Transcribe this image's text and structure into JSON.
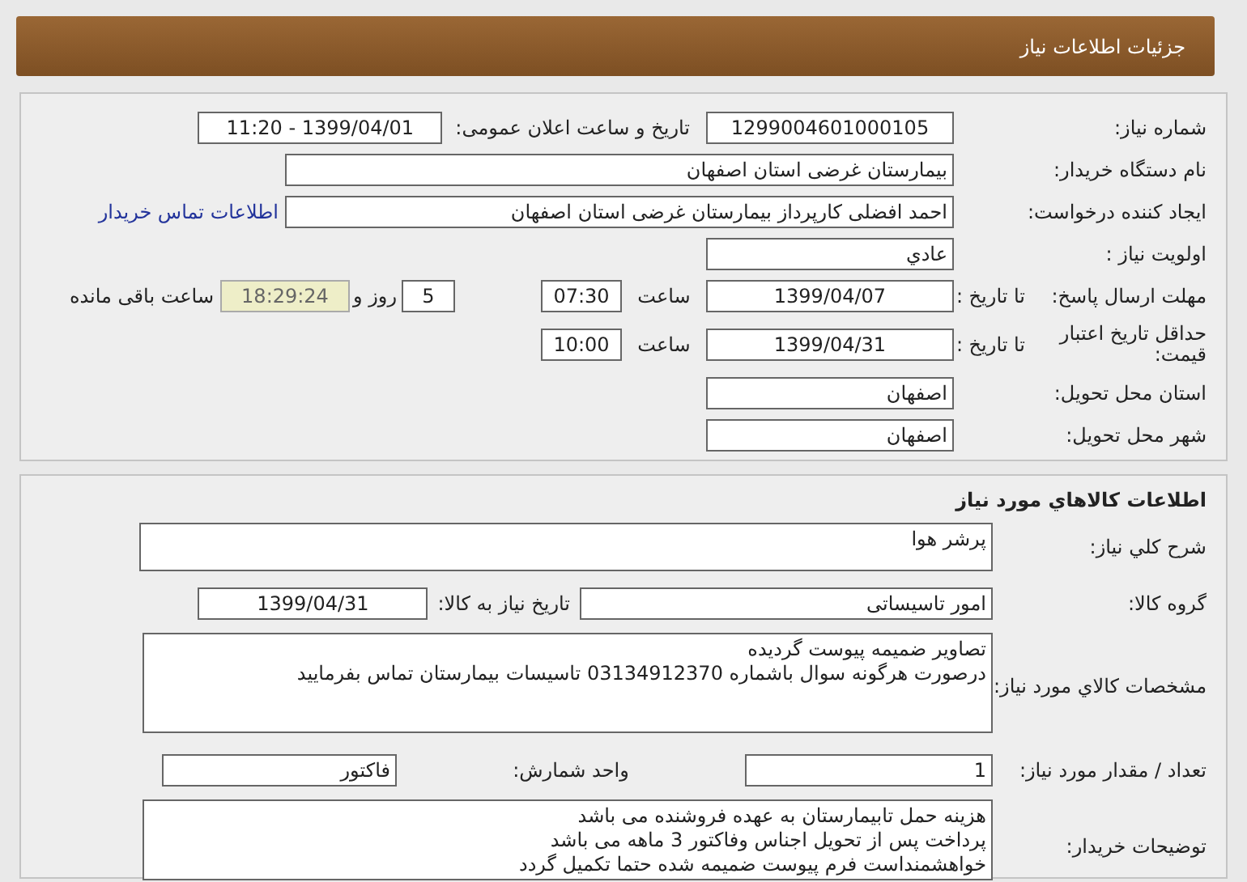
{
  "header": {
    "title": "جزئیات اطلاعات نیاز"
  },
  "need": {
    "number_label": "شماره نیاز:",
    "number": "1299004601000105",
    "announce_label": "تاریخ و ساعت اعلان عمومی:",
    "announce": "1399/04/01 - 11:20",
    "buyer_label": "نام دستگاه خریدار:",
    "buyer": "بیمارستان غرضی استان اصفهان",
    "creator_label": "ایجاد کننده درخواست:",
    "creator": "احمد افضلی کارپرداز بیمارستان غرضی استان اصفهان",
    "contact_link": "اطلاعات تماس خریدار",
    "priority_label": "اولویت نیاز :",
    "priority": "عادي",
    "deadline_label": "مهلت ارسال پاسخ:",
    "deadline_to": "تا تاریخ :",
    "deadline_date": "1399/04/07",
    "deadline_time_label": "ساعت",
    "deadline_time": "07:30",
    "days": "5",
    "days_label": "روز و",
    "remaining": "18:29:24",
    "remaining_label": "ساعت باقی مانده",
    "validity_label": "حداقل تاریخ اعتبار قیمت:",
    "validity_to": "تا تاریخ :",
    "validity_date": "1399/04/31",
    "validity_time_label": "ساعت",
    "validity_time": "10:00",
    "province_label": "استان محل تحویل:",
    "province": "اصفهان",
    "city_label": "شهر محل تحویل:",
    "city": "اصفهان"
  },
  "goods": {
    "title": "اطلاعات کالاهاي مورد نياز",
    "summary_label": "شرح کلي نياز:",
    "summary": "پرشر هوا",
    "group_label": "گروه کالا:",
    "group": "امور تاسیساتی",
    "need_date_label": "تاریخ نیاز به کالا:",
    "need_date": "1399/04/31",
    "specs_label": "مشخصات کالاي مورد نياز:",
    "specs": [
      "تصاویر ضمیمه پیوست گردیده",
      "درصورت هرگونه سوال باشماره 03134912370 تاسیسات بیمارستان تماس بفرمایید"
    ],
    "qty_label": "تعداد / مقدار مورد نیاز:",
    "qty": "1",
    "unit_label": "واحد شمارش:",
    "unit": "فاکتور",
    "notes_label": "توضیحات خریدار:",
    "notes": [
      "هزینه حمل تابیمارستان به عهده فروشنده می باشد",
      "پرداخت پس از تحویل اجناس وفاکتور 3 ماهه می باشد",
      "خواهشمنداست فرم پیوست ضمیمه شده حتما تکمیل گردد"
    ]
  }
}
